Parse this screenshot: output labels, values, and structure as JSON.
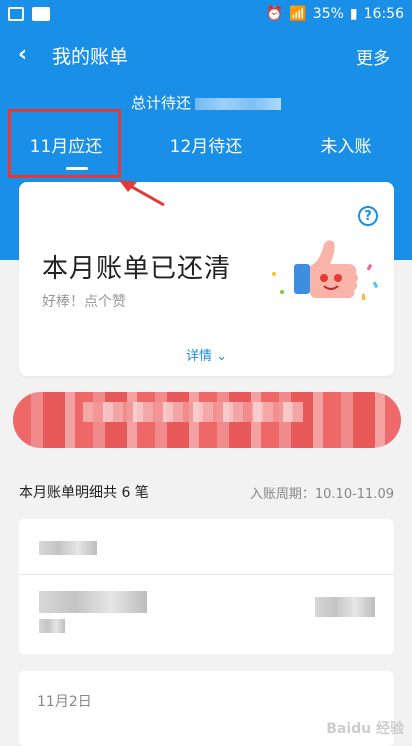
{
  "status_bar": {
    "battery": "35%",
    "time": "16:56"
  },
  "top_bar": {
    "back": "‹",
    "title": "我的账单",
    "more": "更多"
  },
  "summary": {
    "total_label": "总计待还"
  },
  "tabs": [
    {
      "label": "11月应还",
      "selected": true
    },
    {
      "label": "12月待还",
      "selected": false
    },
    {
      "label": "未入账",
      "selected": false
    }
  ],
  "bill_card": {
    "help": "?",
    "status": "本月账单已还清",
    "praise": "好棒！点个赞",
    "details": "详情"
  },
  "list_section": {
    "count_label": "本月账单明细共 6 笔",
    "period": "入账周期：10.10-11.09"
  },
  "date_group": "11月2日",
  "watermark": "Baidu 经验",
  "colors": {
    "brand": "#1a8fe8",
    "highlight": "#e53935"
  }
}
